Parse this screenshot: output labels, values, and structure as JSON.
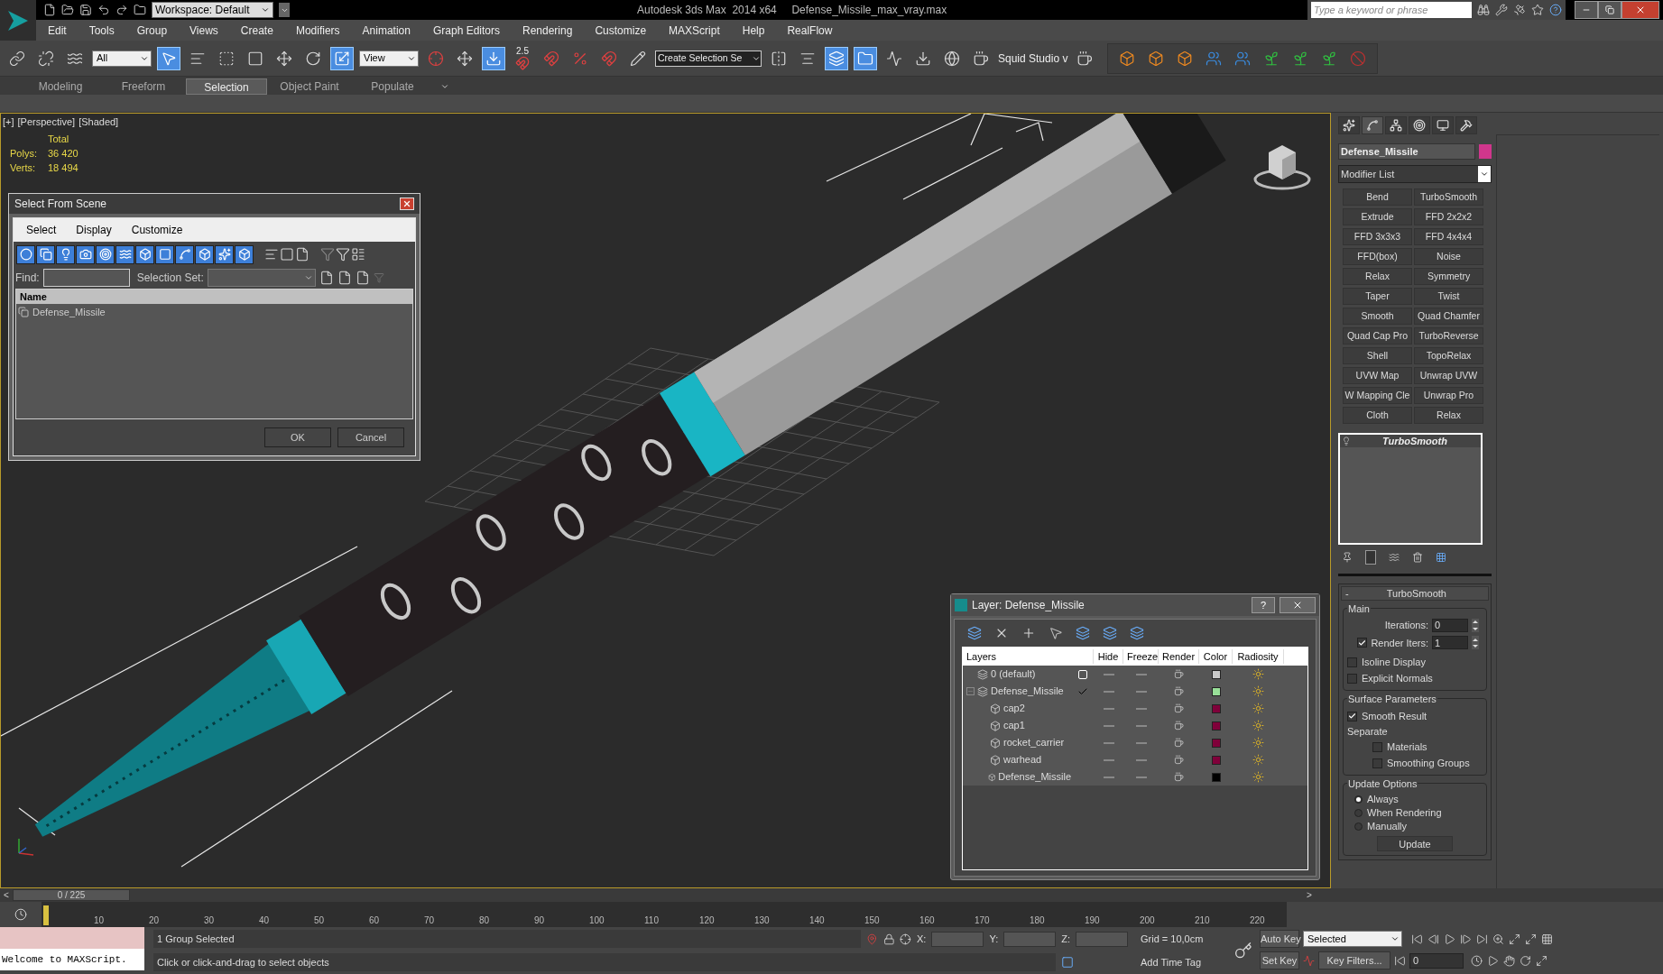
{
  "title_bar": {
    "workspace": "Workspace: Default",
    "title": "Autodesk 3ds Max  2014 x64     Defense_Missile_max_vray.max",
    "search": {
      "placeholder": "Type a keyword or phrase"
    }
  },
  "menu": [
    "Edit",
    "Tools",
    "Group",
    "Views",
    "Create",
    "Modifiers",
    "Animation",
    "Graph Editors",
    "Rendering",
    "Customize",
    "MAXScript",
    "Help",
    "RealFlow"
  ],
  "toolbar": {
    "selection_filter": "All",
    "reference_coord": "View",
    "snap_value": "2.5",
    "named_selection": "Create Selection Se",
    "plugin_label": "Squid Studio v"
  },
  "ribbon_tabs": [
    {
      "label": "Modeling",
      "selected": false
    },
    {
      "label": "Freeform",
      "selected": false
    },
    {
      "label": "Selection",
      "selected": true
    },
    {
      "label": "Object Paint",
      "selected": false
    },
    {
      "label": "Populate",
      "selected": false
    }
  ],
  "viewport": {
    "labels": [
      "[+]",
      "[Perspective]",
      "[Shaded]"
    ],
    "stats": {
      "header": "Total",
      "rows": [
        {
          "label": "Polys:",
          "value": "36 420"
        },
        {
          "label": "Verts:",
          "value": "18 494"
        }
      ]
    }
  },
  "select_dialog": {
    "title": "Select From Scene",
    "menu": [
      "Select",
      "Display",
      "Customize"
    ],
    "find_label": "Find:",
    "selection_set_label": "Selection Set:",
    "column": "Name",
    "items": [
      "Defense_Missile"
    ],
    "buttons": [
      "OK",
      "Cancel"
    ]
  },
  "layer_dialog": {
    "title": "Layer: Defense_Missile",
    "help": "?",
    "columns": [
      "Layers",
      "Hide",
      "Freeze",
      "Render",
      "Color",
      "Radiosity"
    ],
    "layers": [
      {
        "name": "0 (default)",
        "current": false,
        "color": "#c8c8c8"
      },
      {
        "name": "Defense_Missile",
        "current": true,
        "expanded": true,
        "color": "#98e098",
        "children": [
          {
            "name": "cap2",
            "color": "#80003a"
          },
          {
            "name": "cap1",
            "color": "#80003a"
          },
          {
            "name": "rocket_carrier",
            "color": "#80003a"
          },
          {
            "name": "warhead",
            "color": "#80003a"
          },
          {
            "name": "Defense_Missile",
            "color": "#000000"
          }
        ]
      }
    ]
  },
  "command_panel": {
    "object_name": "Defense_Missile",
    "modifier_list": "Modifier List",
    "modifier_buttons": [
      "Bend",
      "TurboSmooth",
      "Extrude",
      "FFD 2x2x2",
      "FFD 3x3x3",
      "FFD 4x4x4",
      "FFD(box)",
      "Noise",
      "Relax",
      "Symmetry",
      "Taper",
      "Twist",
      "Smooth",
      "Quad Chamfer",
      "Quad Cap Pro",
      "TurboReverse",
      "Shell",
      "TopoRelax",
      "UVW Map",
      "Unwrap UVW",
      "W Mapping Cle",
      "Unwrap Pro",
      "Cloth",
      "Relax"
    ],
    "stack": [
      "TurboSmooth"
    ],
    "rollout": {
      "title": "TurboSmooth",
      "collapse": "-",
      "main": {
        "title": "Main",
        "iterations": {
          "label": "Iterations:",
          "value": "0"
        },
        "render_iters": {
          "label": "Render Iters:",
          "value": "1",
          "checked": true
        },
        "isoline": {
          "label": "Isoline Display",
          "checked": false
        },
        "explicit_normals": {
          "label": "Explicit Normals",
          "checked": false
        }
      },
      "surface": {
        "title": "Surface Parameters",
        "smooth_result": {
          "label": "Smooth Result",
          "checked": true
        },
        "separate": "Separate",
        "materials": {
          "label": "Materials",
          "checked": false
        },
        "smoothing_groups": {
          "label": "Smoothing Groups",
          "checked": false
        }
      },
      "update": {
        "title": "Update Options",
        "options": [
          {
            "label": "Always",
            "selected": true
          },
          {
            "label": "When Rendering",
            "selected": false
          },
          {
            "label": "Manually",
            "selected": false
          }
        ],
        "button": "Update"
      }
    }
  },
  "timeline": {
    "prev": "<",
    "next": ">",
    "frame": "0 / 225",
    "level": 0,
    "ticks": [
      "10",
      "20",
      "30",
      "40",
      "50",
      "60",
      "70",
      "80",
      "90",
      "100",
      "110",
      "120",
      "130",
      "140",
      "150",
      "160",
      "170",
      "180",
      "190",
      "200",
      "210",
      "220"
    ]
  },
  "status": {
    "maxscript": "Welcome to MAXScript.",
    "selection": "1 Group Selected",
    "prompt": "Click or click-and-drag to select objects",
    "x_label": "X:",
    "y_label": "Y:",
    "z_label": "Z:",
    "grid": "Grid = 10,0cm",
    "add_time_tag": "Add Time Tag",
    "auto_key": "Auto Key",
    "key_mode": "Selected",
    "set_key": "Set Key",
    "key_filters": "Key Filters...",
    "current_frame": "0"
  }
}
